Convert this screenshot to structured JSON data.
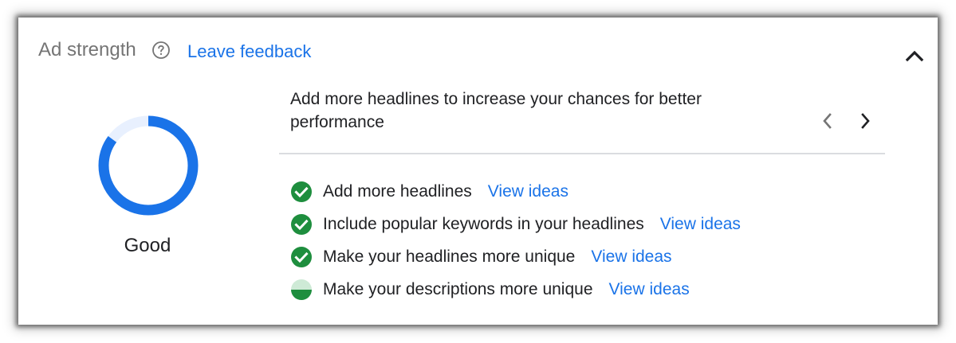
{
  "header": {
    "title": "Ad strength",
    "help_icon": "help-circle-icon",
    "feedback_link": "Leave feedback",
    "collapse_icon": "chevron-up-icon"
  },
  "strength": {
    "label": "Good",
    "progress": 0.85,
    "colors": {
      "fill": "#1a73e8",
      "track": "#e8f0fe"
    }
  },
  "recommendation": {
    "text": "Add more headlines to increase your chances for better performance",
    "prev_icon": "chevron-left-icon",
    "next_icon": "chevron-right-icon"
  },
  "checklist": [
    {
      "text": "Add more headlines",
      "link": "View ideas",
      "status": "complete",
      "icon": "check-circle-icon"
    },
    {
      "text": "Include popular keywords in your headlines",
      "link": "View ideas",
      "status": "complete",
      "icon": "check-circle-icon"
    },
    {
      "text": "Make your headlines more unique",
      "link": "View ideas",
      "status": "complete",
      "icon": "check-circle-icon"
    },
    {
      "text": "Make your descriptions more unique",
      "link": "View ideas",
      "status": "partial",
      "icon": "half-filled-circle-icon"
    }
  ],
  "colors": {
    "link": "#1a73e8",
    "success": "#1e8e3e",
    "partial_track": "#ceead6"
  }
}
